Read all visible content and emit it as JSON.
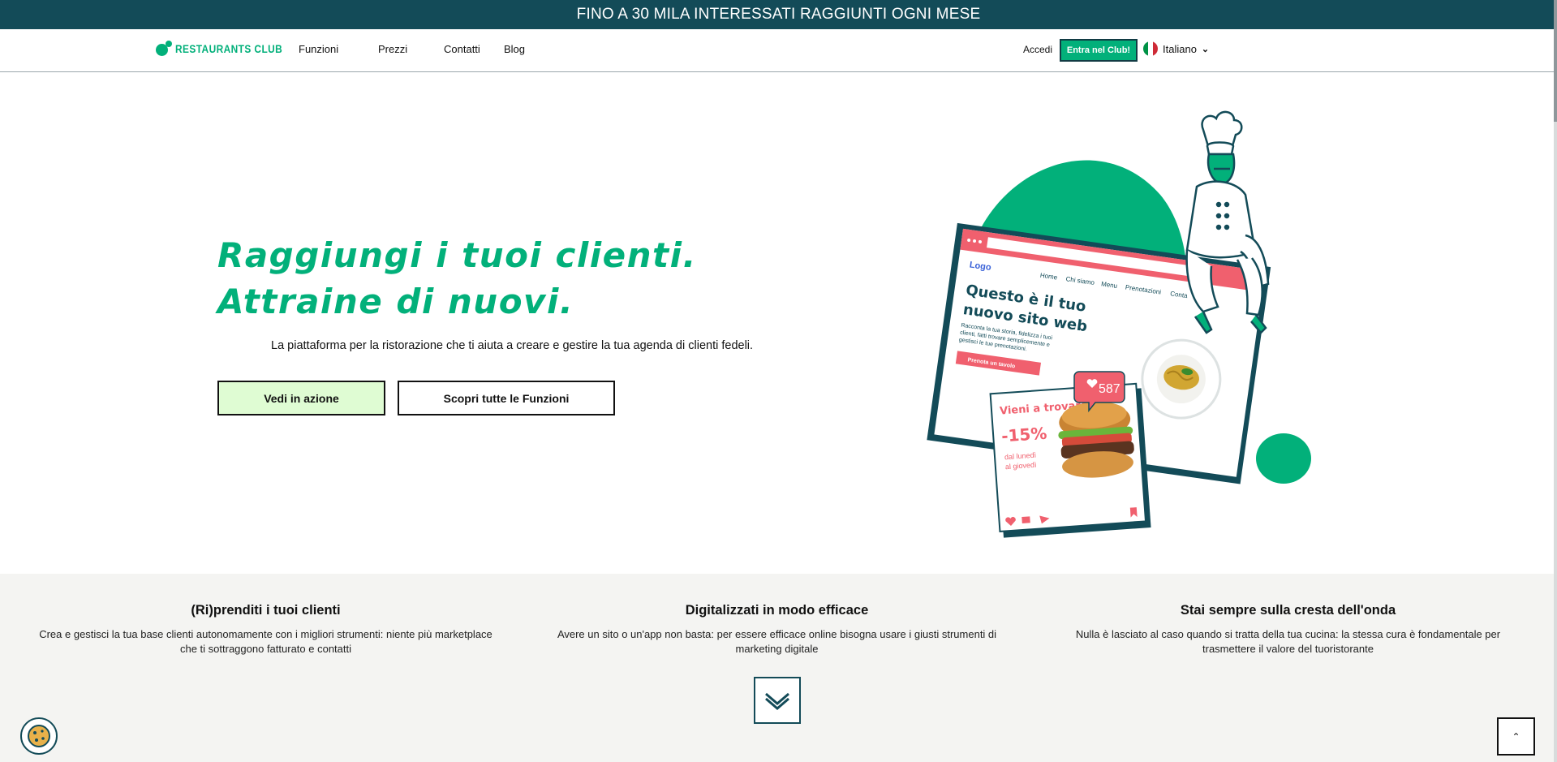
{
  "announcement": "FINO A 30 MILA INTERESSATI RAGGIUNTI OGNI MESE",
  "nav": {
    "logo_text": "RESTAURANTS CLUB",
    "items": [
      "Funzioni",
      "Prezzi",
      "Contatti",
      "Blog"
    ],
    "login": "Accedi",
    "join": "Entra nel Club!",
    "language": "Italiano"
  },
  "hero": {
    "title": "Raggiungi i tuoi clienti. Attraine di nuovi.",
    "subtitle": "La piattaforma per la ristorazione che ti aiuta a creare e gestire la tua agenda di clienti fedeli.",
    "primary_button": "Vedi in azione",
    "secondary_button": "Scopri tutte le Funzioni"
  },
  "illustration": {
    "logo": "Logo",
    "menu": [
      "Home",
      "Chi siamo",
      "Menu",
      "Prenotazioni",
      "Conta"
    ],
    "headline_1": "Questo è il tuo",
    "headline_2": "nuovo sito web",
    "body_1": "Racconta la tua storia, fidelizza i tuoi",
    "body_2": "clienti, fatti trovare semplicemente e",
    "body_3": "gestisci le tue prenotazioni.",
    "cta": "Prenota un tavolo",
    "likes": "587",
    "promo_title": "Vieni a trovarci!",
    "promo_discount": "-15%",
    "promo_days_1": "dal lunedì",
    "promo_days_2": "al giovedì"
  },
  "features": [
    {
      "title": "(Ri)prenditi i tuoi clienti",
      "line1": "Crea e gestisci la tua base clienti autonomamente con i migliori strumenti: niente più marketplace",
      "line2": "che ti sottraggono fatturato e contatti"
    },
    {
      "title": "Digitalizzati in modo efficace",
      "line1": "Avere un sito o un'app non basta: per essere efficace online bisogna usare i giusti strumenti di",
      "line2": "marketing digitale"
    },
    {
      "title": "Stai sempre sulla cresta dell'onda",
      "line1": "Nulla è lasciato al caso quando si tratta della tua cucina: la stessa cura è fondamentale per",
      "line2": "trasmettere il valore del tuoristorante"
    }
  ],
  "icons": {
    "scroll_down": "chevron-down-icon",
    "cookie": "cookie-icon",
    "back_to_top": "chevron-up-icon",
    "back_to_top_glyph": "⌃"
  },
  "colors": {
    "brand_green": "#02b07a",
    "dark_teal": "#134b58",
    "coral": "#f0606e",
    "light_green": "#dffcd3"
  }
}
